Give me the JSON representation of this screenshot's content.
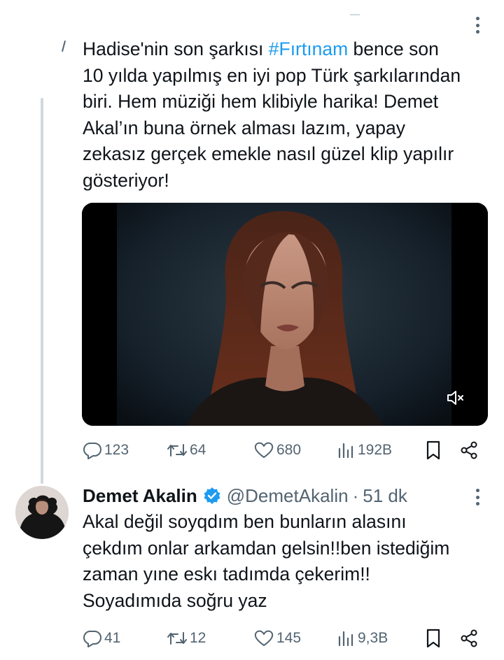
{
  "tweet": {
    "text_before_tag": "Hadise'nin son şarkısı ",
    "hashtag": "#Fırtınam",
    "text_after_tag": " bence son\n10 yılda yapılmış en iyi pop Türk şarkılarından\nbiri. Hem müziği hem klibiyle harika! Demet\nAkal’ın buna örnek alması lazım, yapay\nzekasız gerçek emekle nasıl güzel klip yapılır\ngösteriyor!",
    "media": {
      "type": "video",
      "muted_icon": "speaker-muted-icon"
    },
    "stats": {
      "replies": "123",
      "retweets": "64",
      "likes": "680",
      "views": "192B"
    }
  },
  "reply": {
    "name": "Demet Akalin",
    "handle": "@DemetAkalin",
    "separator": "·",
    "time": "51 dk",
    "text": "Akal değil soyqdım ben bunların alasını\nçekdım onlar arkamdan gelsin!!ben istediğim\nzaman yıne eskı tadımda çekerim!!\nSoyadımıda soğru yaz",
    "stats": {
      "replies": "41",
      "retweets": "12",
      "likes": "145",
      "views": "9,3B"
    }
  },
  "colors": {
    "link": "#1d9bf0",
    "secondary_text": "#536471",
    "verified": "#1d9bf0"
  }
}
